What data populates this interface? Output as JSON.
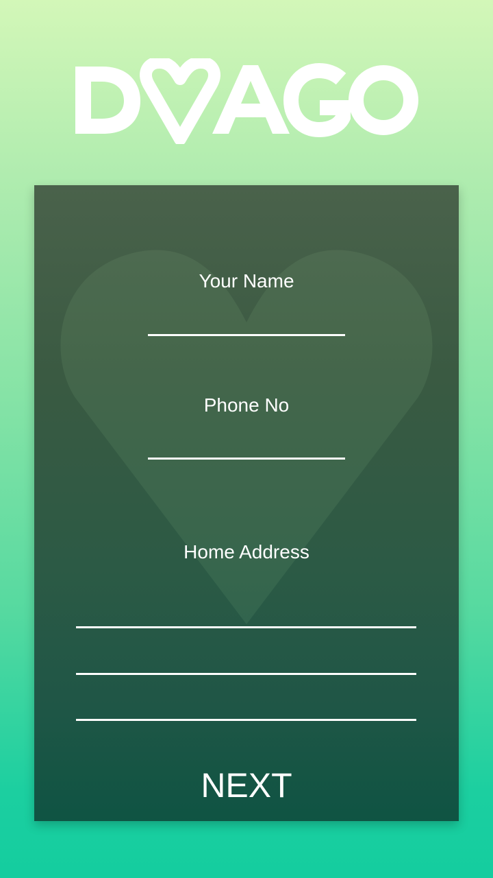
{
  "brand": {
    "logo_text": "DVAGO",
    "logo_color": "#ffffff"
  },
  "form": {
    "name_label": "Your Name",
    "name_value": "",
    "phone_label": "Phone No",
    "phone_value": "",
    "address_label": "Home Address",
    "address_line_1": "",
    "address_line_2": "",
    "address_line_3": "",
    "next_label": "NEXT"
  },
  "colors": {
    "background_top": "#d3f7b8",
    "background_bottom": "#14cd9f",
    "card_top": "#4a624b",
    "card_bottom": "#0f5443",
    "text": "#ffffff"
  }
}
